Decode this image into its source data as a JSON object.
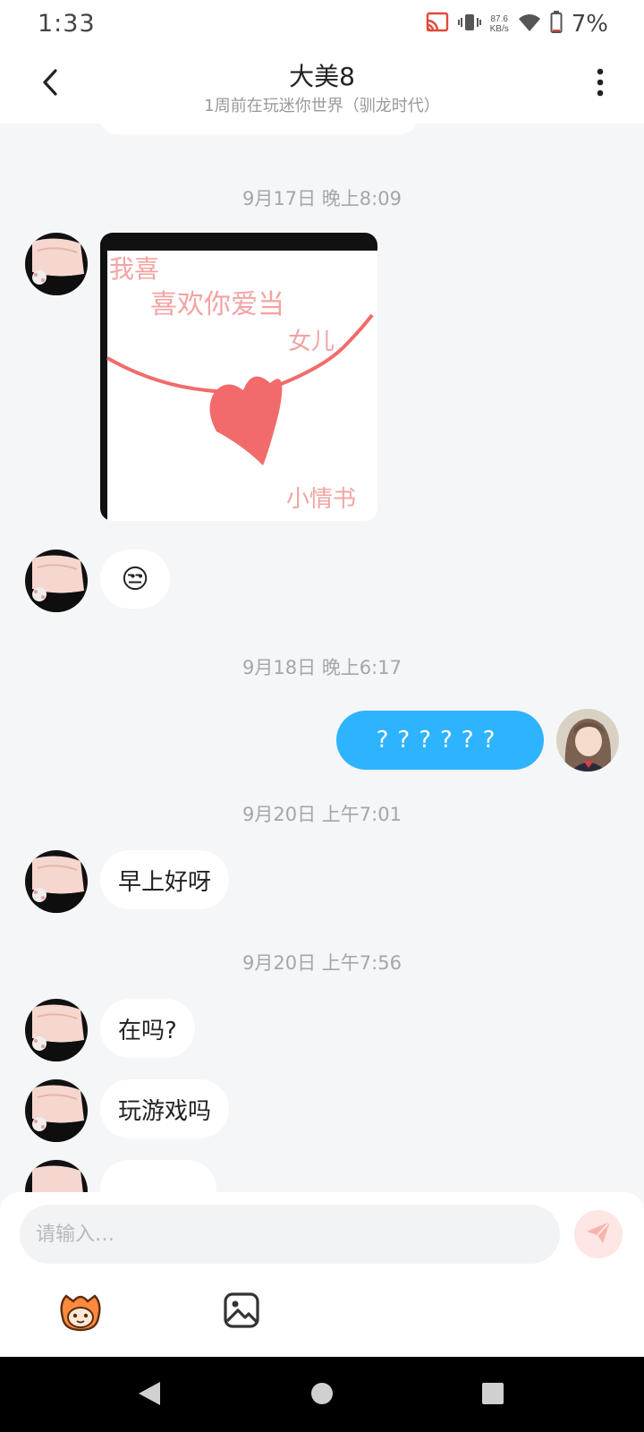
{
  "status_bar": {
    "time": "1:33",
    "net_speed_value": "87.6",
    "net_speed_unit": "KB/s",
    "battery": "7%"
  },
  "header": {
    "title": "大美8",
    "subtitle": "1周前在玩迷你世界（驯龙时代）"
  },
  "messages": [
    {
      "timestamp": "9月17日 晚上8:09",
      "sender": "other",
      "type": "image",
      "drawing_text": [
        "我喜",
        "喜欢你爱当",
        "女儿",
        "小情书"
      ],
      "accent": "#f26b6b"
    },
    {
      "sender": "other",
      "type": "emoji",
      "text": "😒"
    },
    {
      "timestamp": "9月18日 晚上6:17",
      "sender": "self",
      "type": "text",
      "text": "??????"
    },
    {
      "timestamp": "9月20日 上午7:01",
      "sender": "other",
      "type": "text",
      "text": "早上好呀"
    },
    {
      "timestamp": "9月20日 上午7:56",
      "sender": "other",
      "type": "text",
      "text": "在吗?"
    },
    {
      "sender": "other",
      "type": "text",
      "text": "玩游戏吗"
    }
  ],
  "input": {
    "placeholder": "请输入…"
  },
  "icons": {
    "back": "back-arrow-icon",
    "more": "more-vertical-icon",
    "send": "send-icon",
    "sticker": "sticker-mascot-icon",
    "image": "image-icon",
    "nav_back": "nav-back-icon",
    "nav_home": "nav-home-icon",
    "nav_recents": "nav-recents-icon"
  },
  "colors": {
    "accent_blue": "#2eb3ff",
    "send_button": "#fde6e3",
    "background": "#f5f6f8"
  }
}
